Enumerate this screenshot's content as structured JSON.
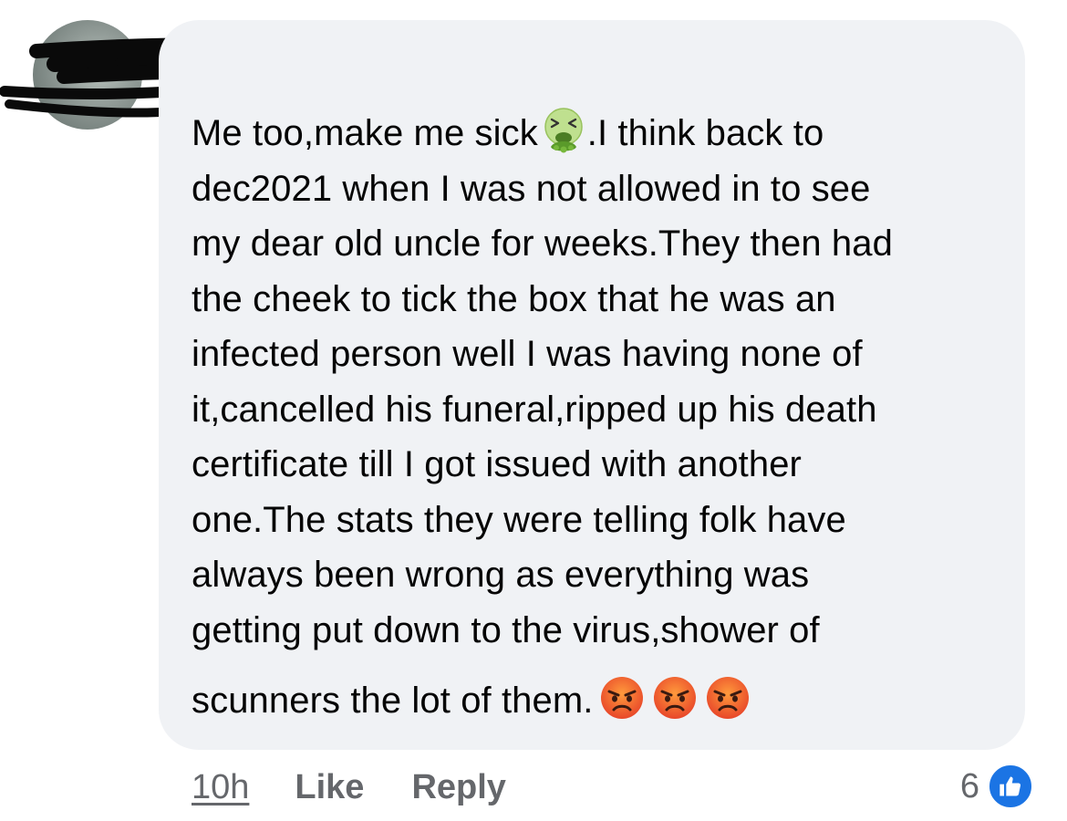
{
  "comment": {
    "lines": [
      "Me too,make me sick",
      ".I think back to",
      "dec2021 when I was not allowed in to see",
      "my dear old uncle for weeks.They then had",
      "the cheek to tick the box that he was an",
      "infected person well I was having none of",
      "it,cancelled his funeral,ripped up his death",
      "certificate till I got issued with another",
      "one.The stats they were telling folk have",
      "always been wrong as everything was",
      "getting put down to the virus,shower of",
      "scunners the lot of them."
    ],
    "emojis": {
      "inline": "nauseated-face",
      "trailing": [
        "angry-face",
        "angry-face",
        "angry-face"
      ]
    }
  },
  "actions": {
    "timestamp": "10h",
    "like_label": "Like",
    "reply_label": "Reply"
  },
  "reactions": {
    "count": "6",
    "type": "like-icon"
  },
  "colors": {
    "bubble": "#f0f2f5",
    "text": "#050505",
    "meta": "#65676b",
    "like_blue": "#1b74e4"
  }
}
